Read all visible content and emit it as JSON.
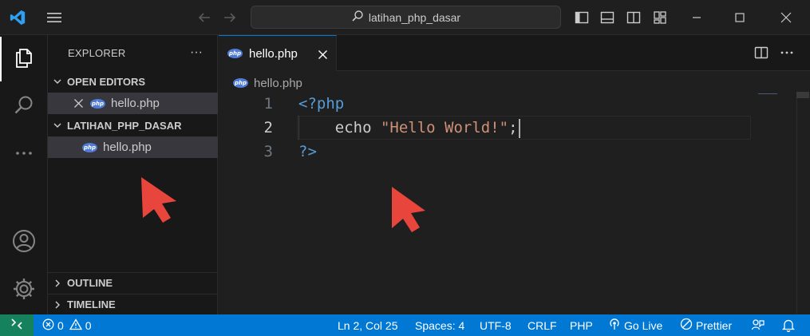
{
  "titlebar": {
    "search_text": "latihan_php_dasar"
  },
  "explorer": {
    "title": "EXPLORER",
    "more": "···",
    "open_editors": {
      "title": "OPEN EDITORS",
      "files": [
        {
          "name": "hello.php",
          "icon_text": "php"
        }
      ]
    },
    "workspace": {
      "title": "LATIHAN_PHP_DASAR",
      "files": [
        {
          "name": "hello.php",
          "icon_text": "php"
        }
      ]
    },
    "outline_title": "OUTLINE",
    "timeline_title": "TIMELINE"
  },
  "editor": {
    "tab": {
      "label": "hello.php",
      "icon_text": "php"
    },
    "breadcrumb": {
      "file": "hello.php",
      "icon_text": "php"
    },
    "lines": [
      {
        "number": "1",
        "tokens": [
          {
            "text": "<?php",
            "kind": "kw"
          }
        ]
      },
      {
        "number": "2",
        "tokens": [
          {
            "text": "    echo ",
            "kind": "plain"
          },
          {
            "text": "\"Hello World!\"",
            "kind": "str"
          },
          {
            "text": ";",
            "kind": "plain"
          }
        ]
      },
      {
        "number": "3",
        "tokens": [
          {
            "text": "?>",
            "kind": "kw"
          }
        ]
      }
    ],
    "active_line": 2
  },
  "statusbar": {
    "errors": "0",
    "warnings": "0",
    "position": "Ln 2, Col 25",
    "spaces": "Spaces: 4",
    "encoding": "UTF-8",
    "eol": "CRLF",
    "language": "PHP",
    "go_live": "Go Live",
    "prettier": "Prettier"
  },
  "colors": {
    "accent": "#0078d4",
    "remote": "#16825d",
    "annotation_arrow": "#e8453c",
    "keyword": "#569cd6",
    "string": "#ce9178"
  },
  "icons": [
    "vscode-logo-icon",
    "menu-icon",
    "back-arrow-icon",
    "forward-arrow-icon",
    "search-icon",
    "toggle-sidebar-icon",
    "toggle-panel-icon",
    "toggle-secondary-sidebar-icon",
    "customize-layout-icon",
    "minimize-icon",
    "maximize-icon",
    "close-icon",
    "explorer-icon",
    "search-view-icon",
    "more-icon",
    "account-icon",
    "settings-gear-icon",
    "php-file-icon",
    "split-editor-icon",
    "remote-icon",
    "error-icon",
    "warning-icon",
    "broadcast-icon",
    "prettier-icon",
    "feedback-icon",
    "bell-icon"
  ]
}
